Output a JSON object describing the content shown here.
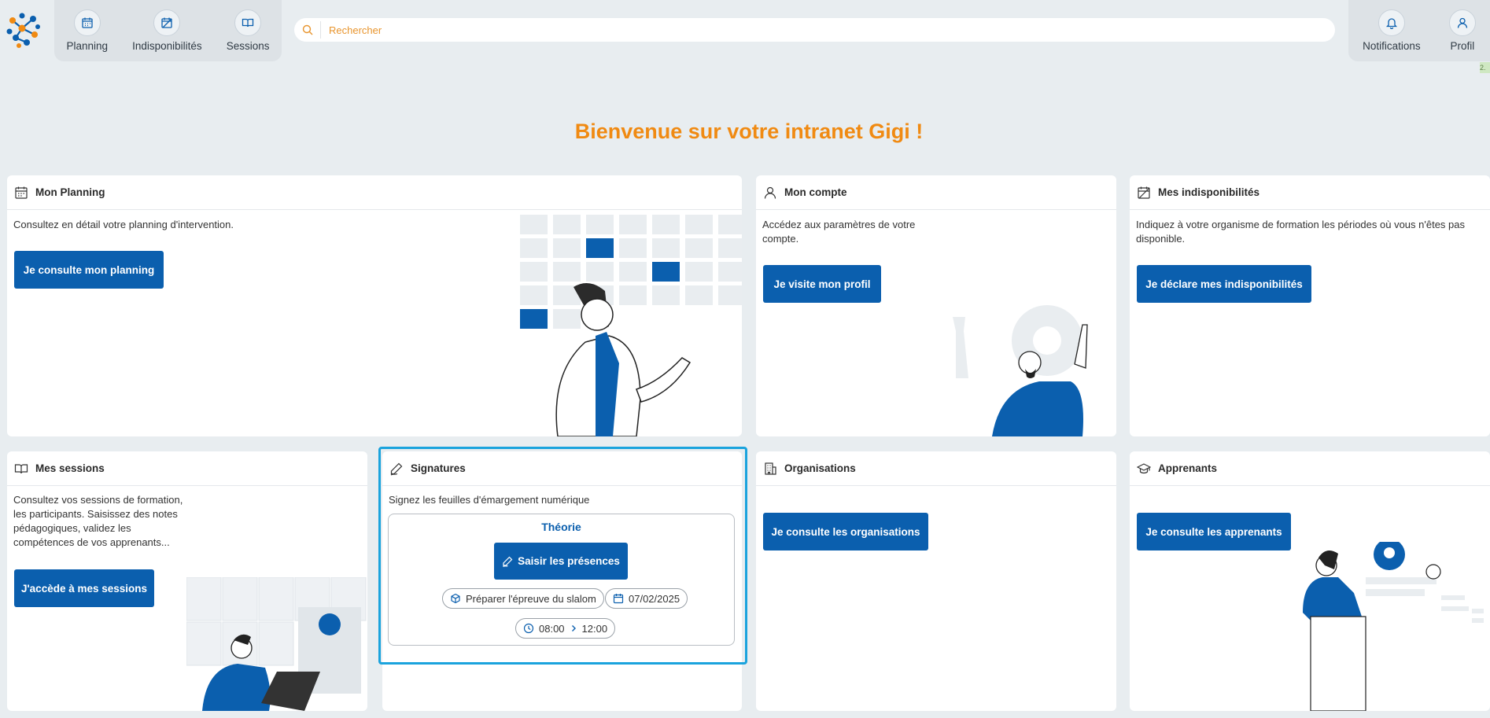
{
  "nav": {
    "left": [
      {
        "label": "Planning",
        "icon": "calendar-icon"
      },
      {
        "label": "Indisponibilités",
        "icon": "calendar-off-icon"
      },
      {
        "label": "Sessions",
        "icon": "book-icon"
      }
    ],
    "right": [
      {
        "label": "Notifications",
        "icon": "bell-icon"
      },
      {
        "label": "Profil",
        "icon": "user-icon"
      }
    ]
  },
  "search": {
    "placeholder": "Rechercher"
  },
  "version": "2.",
  "welcome": "Bienvenue sur votre intranet Gigi !",
  "cards": {
    "planning": {
      "title": "Mon Planning",
      "desc": "Consultez en détail votre planning d'intervention.",
      "button": "Je consulte mon planning"
    },
    "compte": {
      "title": "Mon compte",
      "desc": "Accédez aux paramètres de votre compte.",
      "button": "Je visite mon profil"
    },
    "indispo": {
      "title": "Mes indisponibilités",
      "desc": "Indiquez à votre organisme de formation les périodes où vous n'êtes pas disponible.",
      "button": "Je déclare mes indisponibilités"
    },
    "sessions": {
      "title": "Mes sessions",
      "desc": "Consultez vos sessions de formation, les participants. Saisissez des notes pédagogiques, validez les compétences de vos apprenants...",
      "button": "J'accède à mes sessions"
    },
    "signatures": {
      "title": "Signatures",
      "desc": "Signez les feuilles d'émargement numérique",
      "session": {
        "title": "Théorie",
        "button": "Saisir les présences",
        "module": "Préparer l'épreuve du slalom",
        "date": "07/02/2025",
        "start": "08:00",
        "end": "12:00"
      }
    },
    "organisations": {
      "title": "Organisations",
      "button": "Je consulte les organisations"
    },
    "apprenants": {
      "title": "Apprenants",
      "button": "Je consulte les apprenants"
    }
  },
  "colors": {
    "brand_blue": "#0b5fae",
    "accent_orange": "#f08a12",
    "highlight": "#1aa3dd"
  }
}
